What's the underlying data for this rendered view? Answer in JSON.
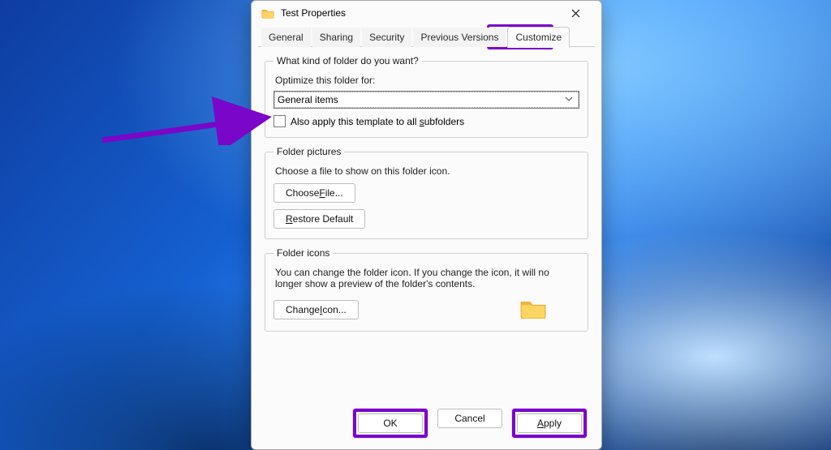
{
  "window": {
    "title": "Test Properties"
  },
  "tabs": {
    "general": "General",
    "sharing": "Sharing",
    "security": "Security",
    "previous": "Previous Versions",
    "customize": "Customize"
  },
  "section1": {
    "legend": "What kind of folder do you want?",
    "optimize_label": "Optimize this folder for:",
    "combo_value": "General items",
    "subfolders_label": "Also apply this template to all subfolders"
  },
  "section2": {
    "legend": "Folder pictures",
    "desc": "Choose a file to show on this folder icon.",
    "choose_file": "Choose File...",
    "restore_default": "Restore Default"
  },
  "section3": {
    "legend": "Folder icons",
    "desc": "You can change the folder icon. If you change the icon, it will no longer show a preview of the folder's contents.",
    "change_icon": "Change Icon..."
  },
  "buttons": {
    "ok": "OK",
    "cancel": "Cancel",
    "apply": "Apply"
  }
}
